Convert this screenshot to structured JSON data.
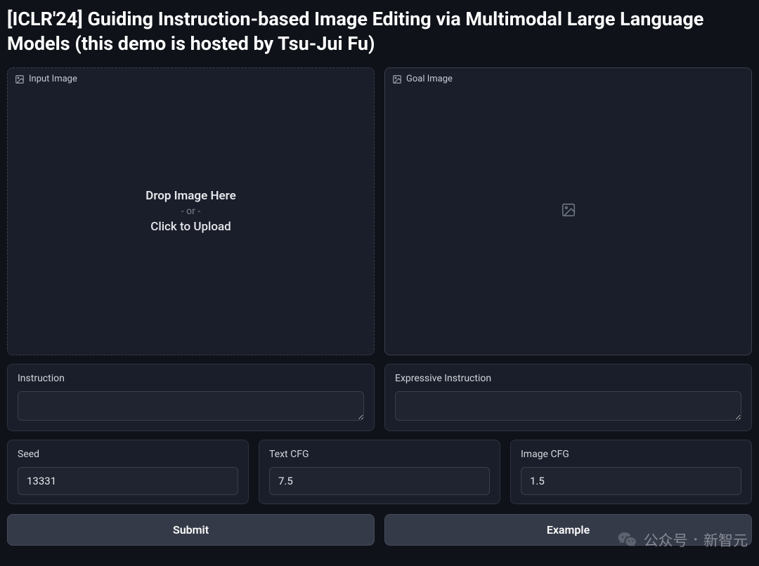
{
  "title": "[ICLR'24] Guiding Instruction-based Image Editing via Multimodal Large Language Models (this demo is hosted by Tsu-Jui Fu)",
  "input_image": {
    "label": "Input Image",
    "drop_text": "Drop Image Here",
    "or_text": "- or -",
    "click_text": "Click to Upload"
  },
  "goal_image": {
    "label": "Goal Image"
  },
  "instruction": {
    "label": "Instruction",
    "value": ""
  },
  "expressive_instruction": {
    "label": "Expressive Instruction",
    "value": ""
  },
  "params": {
    "seed": {
      "label": "Seed",
      "value": "13331"
    },
    "text_cfg": {
      "label": "Text CFG",
      "value": "7.5"
    },
    "image_cfg": {
      "label": "Image CFG",
      "value": "1.5"
    }
  },
  "buttons": {
    "submit": "Submit",
    "example": "Example"
  },
  "watermark": {
    "prefix": "公众号",
    "dot": "·",
    "suffix": "新智元"
  }
}
